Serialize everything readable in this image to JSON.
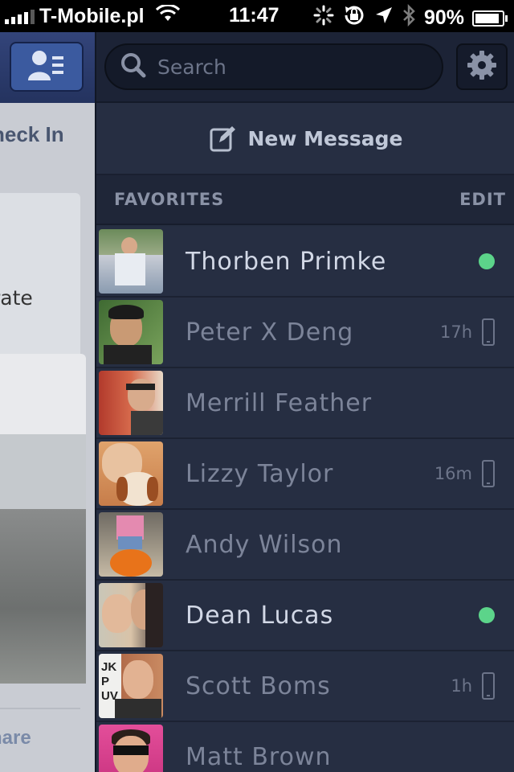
{
  "status_bar": {
    "carrier": "T-Mobile.pl",
    "time": "11:47",
    "battery": "90%",
    "battery_level": 0.9
  },
  "left_panel": {
    "checkin_label": "heck In",
    "card_text": "rate",
    "share_label": "hare"
  },
  "search": {
    "placeholder": "Search"
  },
  "new_message": {
    "label": "New Message"
  },
  "favorites": {
    "title": "FAVORITES",
    "edit_label": "EDIT"
  },
  "contacts": [
    {
      "name": "Thorben Primke",
      "status": "online",
      "time": ""
    },
    {
      "name": "Peter X Deng",
      "status": "mobile",
      "time": "17h"
    },
    {
      "name": "Merrill Feather",
      "status": "offline",
      "time": ""
    },
    {
      "name": "Lizzy Taylor",
      "status": "mobile",
      "time": "16m"
    },
    {
      "name": "Andy Wilson",
      "status": "offline",
      "time": ""
    },
    {
      "name": "Dean Lucas",
      "status": "online",
      "time": ""
    },
    {
      "name": "Scott Boms",
      "status": "mobile",
      "time": "1h"
    },
    {
      "name": "Matt Brown",
      "status": "offline",
      "time": ""
    }
  ],
  "colors": {
    "panel_bg": "#252d40",
    "online": "#5cd48a",
    "facebook_blue": "#3b5a9f"
  }
}
